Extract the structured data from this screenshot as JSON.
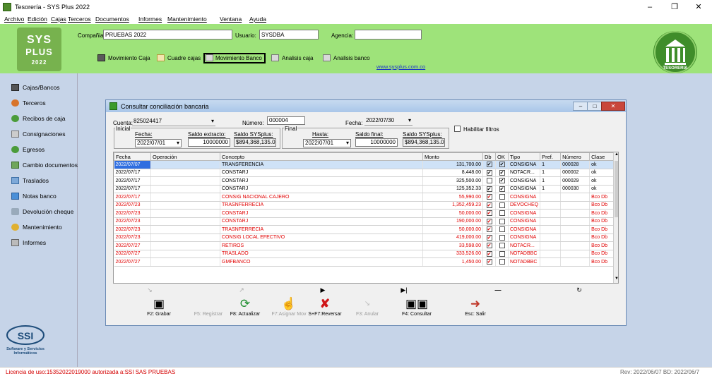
{
  "window": {
    "title": "Tesorería - SYS Plus 2022"
  },
  "menu": [
    "Archivo",
    "Edición",
    "Cajas",
    "Terceros",
    "Documentos",
    "Informes",
    "Mantenimiento",
    "Ventana",
    "Ayuda"
  ],
  "logo": {
    "line1": "SYS",
    "line2": "PLUS",
    "line3": "2022"
  },
  "header": {
    "company_label": "Compañia:",
    "company_value": "PRUEBAS 2022",
    "user_label": "Usuario:",
    "user_value": "SYSDBA",
    "agency_label": "Agencia:",
    "agency_value": "",
    "buttons": [
      "Movimiento Caja",
      "Cuadre cajas",
      "Movimiento Banco",
      "Analisis caja",
      "Analisis banco"
    ],
    "link": "www.sysplus.com.co",
    "badge": "TESORERIA"
  },
  "sidebar": [
    "Cajas/Bancos",
    "Terceros",
    "Recibos de caja",
    "Consignaciones",
    "Egresos",
    "Cambio documentos",
    "Traslados",
    "Notas banco",
    "Devolución cheque",
    "Mantenimiento",
    "Informes"
  ],
  "ssi": {
    "name": "SSI",
    "subtitle": "Software y Servicios Informáticos"
  },
  "status": {
    "license": "Licencia de uso:15352022019000 autorizada a:SSI SAS PRUEBAS",
    "rev": "Rev: 2022/06/07 BD: 2022/06/7"
  },
  "dialog": {
    "title": "Consultar conciliación bancaria",
    "cuenta_label": "Cuenta:",
    "cuenta_value": "825024417",
    "numero_label": "Número:",
    "numero_value": "000004",
    "fecha_label": "Fecha:",
    "fecha_value": "2022/07/30",
    "habilitar_label": "Habilitar filtros",
    "inicial": {
      "group_label": "Inicial",
      "fecha_label": "Fecha:",
      "fecha_value": "2022/07/01",
      "saldo_extracto_label": "Saldo extracto:",
      "saldo_extracto_value": "10000000",
      "saldo_sys_label": "Saldo SYSplus:",
      "saldo_sys_value": "$894,368,135.0"
    },
    "final": {
      "group_label": "Final",
      "hasta_label": "Hasta:",
      "hasta_value": "2022/07/01",
      "saldo_final_label": "Saldo final:",
      "saldo_final_value": "10000000",
      "saldo_sys_label": "Saldo SYSplus:",
      "saldo_sys_value": "$894,368,135.0"
    }
  },
  "grid": {
    "columns": [
      "Fecha",
      "Operación",
      "Concepto",
      "Monto",
      "Db",
      "OK",
      "Tipo",
      "Pref.",
      "Número",
      "Clase"
    ],
    "rows": [
      {
        "fecha": "2022/07/07",
        "op": "",
        "concepto": "TRANSFERENCIA",
        "monto": "131,700.00",
        "db": true,
        "ok": true,
        "tipo": "CONSIGNA",
        "pref": "1",
        "numero": "000028",
        "clase": "ok",
        "red": false,
        "selected": true
      },
      {
        "fecha": "2022/07/17",
        "op": "",
        "concepto": "CONSTARJ",
        "monto": "8,448.00",
        "db": true,
        "ok": true,
        "tipo": "NOTACR...",
        "pref": "1",
        "numero": "000002",
        "clase": "ok",
        "red": false,
        "selected": false
      },
      {
        "fecha": "2022/07/17",
        "op": "",
        "concepto": "CONSTARJ",
        "monto": "325,500.00",
        "db": false,
        "ok": true,
        "tipo": "CONSIGNA",
        "pref": "1",
        "numero": "000029",
        "clase": "ok",
        "red": false,
        "selected": false
      },
      {
        "fecha": "2022/07/17",
        "op": "",
        "concepto": "CONSTARJ",
        "monto": "125,352.33",
        "db": true,
        "ok": true,
        "tipo": "CONSIGNA",
        "pref": "1",
        "numero": "000030",
        "clase": "ok",
        "red": false,
        "selected": false
      },
      {
        "fecha": "2022/07/17",
        "op": "",
        "concepto": "CONSIG NACIONAL CAJERO",
        "monto": "55,990.00",
        "db": true,
        "ok": false,
        "tipo": "CONSIGNA",
        "pref": "",
        "numero": "",
        "clase": "Bco Db",
        "red": true,
        "selected": false
      },
      {
        "fecha": "2022/07/23",
        "op": "",
        "concepto": "TRASNFERRECIA",
        "monto": "1,352,459.23",
        "db": true,
        "ok": false,
        "tipo": "DEVOCHEQ",
        "pref": "",
        "numero": "",
        "clase": "Bco Db",
        "red": true,
        "selected": false
      },
      {
        "fecha": "2022/07/23",
        "op": "",
        "concepto": "CONSTARJ",
        "monto": "50,000.00",
        "db": true,
        "ok": false,
        "tipo": "CONSIGNA",
        "pref": "",
        "numero": "",
        "clase": "Bco Db",
        "red": true,
        "selected": false
      },
      {
        "fecha": "2022/07/23",
        "op": "",
        "concepto": "CONSTARJ",
        "monto": "190,000.00",
        "db": true,
        "ok": false,
        "tipo": "CONSIGNA",
        "pref": "",
        "numero": "",
        "clase": "Bco Db",
        "red": true,
        "selected": false
      },
      {
        "fecha": "2022/07/23",
        "op": "",
        "concepto": "TRASNFERRECIA",
        "monto": "50,000.00",
        "db": true,
        "ok": false,
        "tipo": "CONSIGNA",
        "pref": "",
        "numero": "",
        "clase": "Bco Db",
        "red": true,
        "selected": false
      },
      {
        "fecha": "2022/07/23",
        "op": "",
        "concepto": "CONSIG LOCAL EFECTIVO",
        "monto": "419,000.00",
        "db": true,
        "ok": false,
        "tipo": "CONSIGNA",
        "pref": "",
        "numero": "",
        "clase": "Bco Db",
        "red": true,
        "selected": false
      },
      {
        "fecha": "2022/07/27",
        "op": "",
        "concepto": "RETIROS",
        "monto": "33,598.00",
        "db": true,
        "ok": false,
        "tipo": "NOTACR...",
        "pref": "",
        "numero": "",
        "clase": "Bco Db",
        "red": true,
        "selected": false
      },
      {
        "fecha": "2022/07/27",
        "op": "",
        "concepto": "TRASLADO",
        "monto": "333,526.00",
        "db": true,
        "ok": false,
        "tipo": "NOTADBBC",
        "pref": "",
        "numero": "",
        "clase": "Bco Db",
        "red": true,
        "selected": false
      },
      {
        "fecha": "2022/07/27",
        "op": "",
        "concepto": "GMFBANCO",
        "monto": "1,450.00",
        "db": true,
        "ok": false,
        "tipo": "NOTADBBC",
        "pref": "",
        "numero": "",
        "clase": "Bco Db",
        "red": true,
        "selected": false
      }
    ]
  },
  "actions": [
    {
      "label": "F2: Grabar",
      "icon": "save-icon",
      "enabled": true
    },
    {
      "label": "F5: Registrar",
      "icon": "",
      "enabled": false
    },
    {
      "label": "F8: Actualizar",
      "icon": "refresh-icon",
      "enabled": true
    },
    {
      "label": "F7:Asignar Mov",
      "icon": "hand-icon",
      "enabled": false
    },
    {
      "label": "S+F7:Reversar",
      "icon": "reverse-x-icon",
      "enabled": true
    },
    {
      "label": "F3: Anular",
      "icon": "",
      "enabled": false
    },
    {
      "label": "F4: Consultar",
      "icon": "binoculars-icon",
      "enabled": true
    },
    {
      "label": "Esc: Salir",
      "icon": "exit-icon",
      "enabled": true
    }
  ]
}
